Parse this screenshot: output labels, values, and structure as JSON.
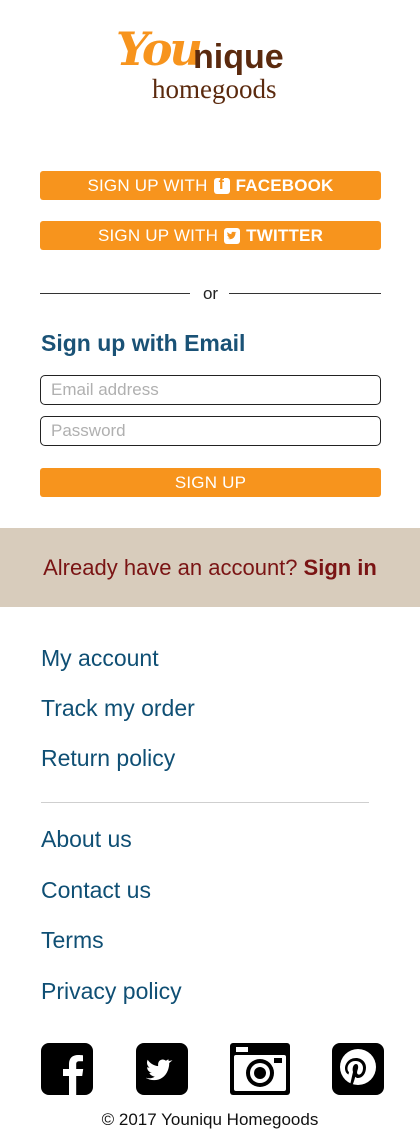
{
  "brand": {
    "logo_you": "You",
    "logo_nique": "nique",
    "logo_sub": "homegoods",
    "accent_color": "#f7941d",
    "brown_color": "#5b2a0e"
  },
  "social_signup": {
    "facebook_prefix": "SIGN UP WITH",
    "facebook_name": "FACEBOOK",
    "twitter_prefix": "SIGN UP WITH",
    "twitter_name": "TWITTER"
  },
  "divider_text": "or",
  "email_form": {
    "heading": "Sign up with Email",
    "email_placeholder": "Email address",
    "email_value": "",
    "password_placeholder": "Password",
    "password_value": "",
    "submit_label": "SIGN UP"
  },
  "signin_prompt": {
    "text": "Already have an account?",
    "link": "Sign in"
  },
  "footer_nav": {
    "group1": [
      "My account",
      "Track my order",
      "Return policy"
    ],
    "group2": [
      "About us",
      "Contact us",
      "Terms",
      "Privacy policy"
    ]
  },
  "social_icons": [
    "facebook-icon",
    "twitter-icon",
    "instagram-icon",
    "pinterest-icon"
  ],
  "copyright": "© 2017 Youniqu Homegoods"
}
